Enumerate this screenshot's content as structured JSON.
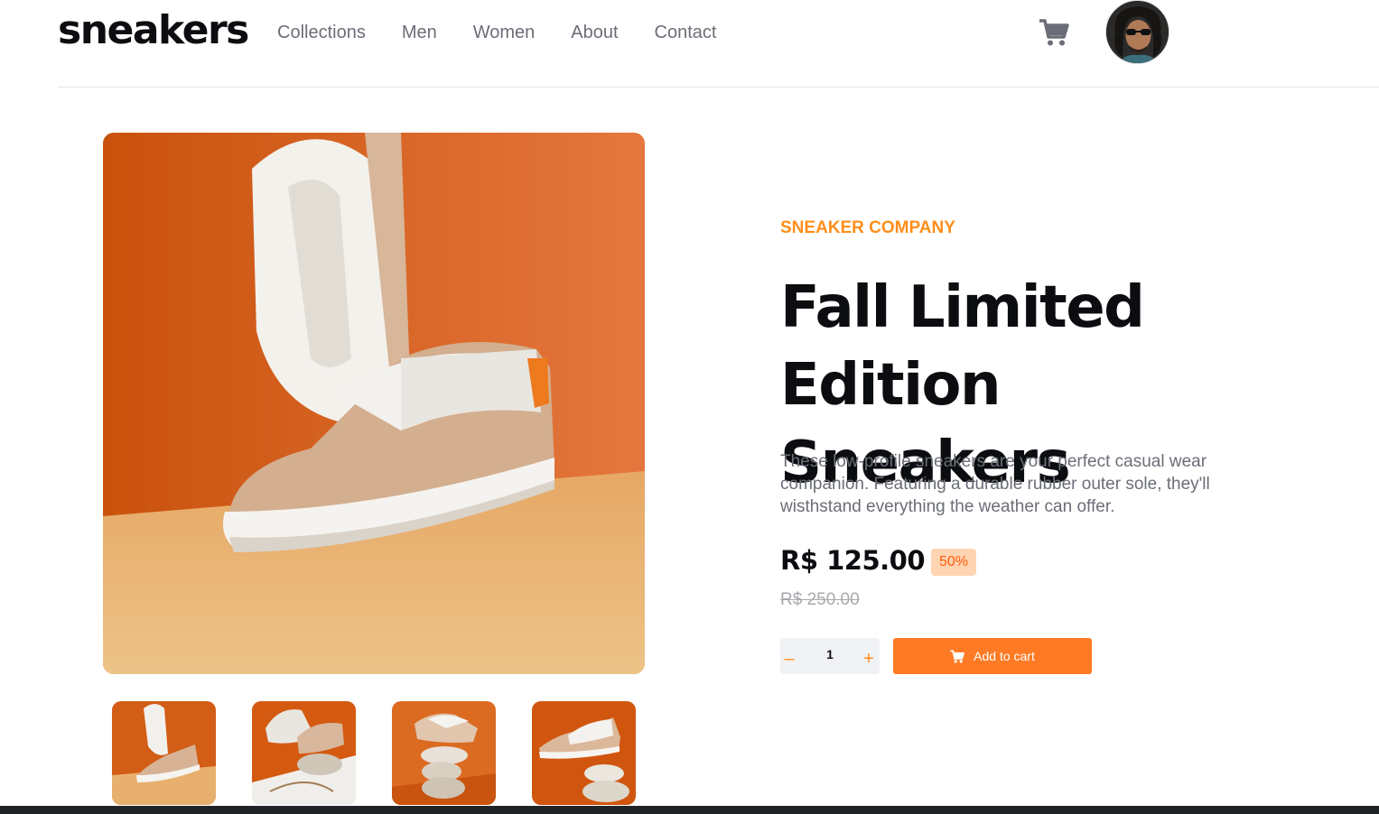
{
  "header": {
    "logo": "sneakers",
    "nav": [
      "Collections",
      "Men",
      "Women",
      "About",
      "Contact"
    ],
    "cart_icon": "cart-icon",
    "avatar_icon": "user-avatar"
  },
  "product": {
    "company": "SNEAKER COMPANY",
    "title_line1": "Fall Limited Edition",
    "title_line2": "Sneakers",
    "description": "These low-profile sneakers are your perfect casual wear companion. Featuring a durable rubber outer sole, they'll wisthstand everything the weather can offer.",
    "price": "R$ 125.00",
    "discount": "50%",
    "original_price": "R$ 250.00",
    "quantity": "1",
    "minus_label": "–",
    "plus_label": "+",
    "add_to_cart": "Add to cart"
  },
  "gallery": {
    "thumbnails": [
      "product-thumbnail-1",
      "product-thumbnail-2",
      "product-thumbnail-3",
      "product-thumbnail-4"
    ]
  },
  "colors": {
    "accent": "#ff7a24",
    "accent_text": "#ff8e1a",
    "discount_bg": "#ffd4b3",
    "dark": "#0c0d10",
    "muted": "#6b6e77"
  }
}
